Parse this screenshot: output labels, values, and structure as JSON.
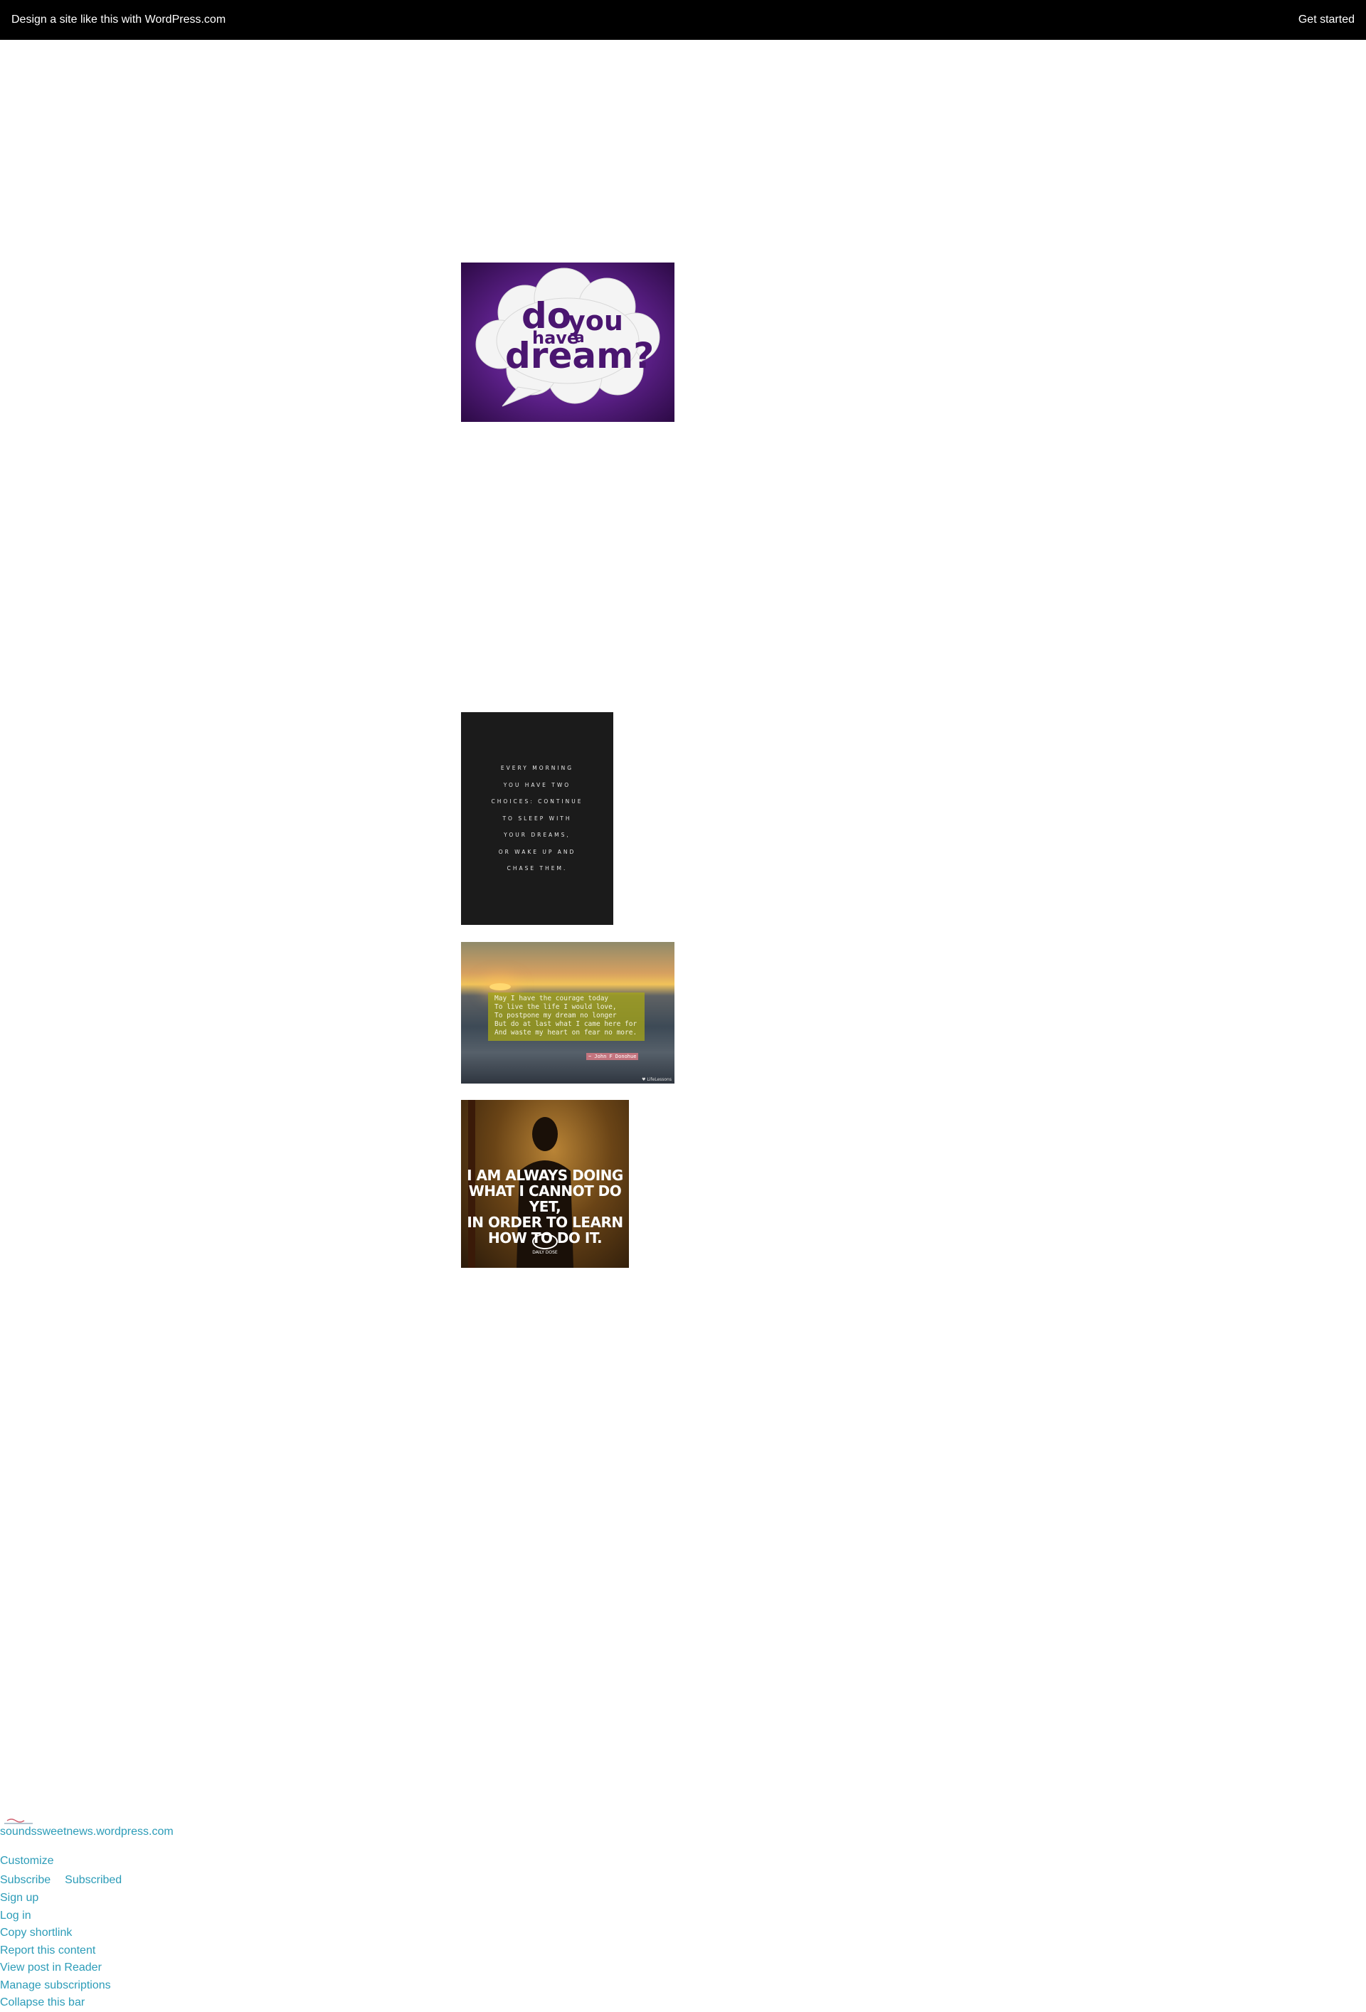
{
  "topbar": {
    "left_text": "Design a site like this with WordPress.com",
    "right_text": "Get started"
  },
  "images": [
    {
      "id": "dream",
      "text": [
        "do",
        "you",
        "have",
        "a",
        "dream?"
      ],
      "colors": {
        "background": "#5a1f86",
        "cloud": "#f4f4f4",
        "text": "#4a1570"
      }
    },
    {
      "id": "morning",
      "lines": [
        "EVERY MORNING",
        "YOU HAVE TWO",
        "CHOICES: CONTINUE",
        "TO SLEEP WITH",
        "YOUR DREAMS,",
        "OR WAKE UP AND",
        "CHASE THEM."
      ]
    },
    {
      "id": "sunset",
      "lines": [
        "May I have the courage today",
        "To live the life I would love,",
        "To postpone my dream no longer",
        "But do at last what I came here for",
        "And waste my heart on fear no more."
      ],
      "author": "~ John F Donohue",
      "watermark": "♥ LifeLessons"
    },
    {
      "id": "always-doing",
      "lines": [
        "I AM ALWAYS DOING",
        "WHAT I CANNOT DO YET,",
        "IN ORDER TO LEARN",
        "HOW TO DO IT."
      ],
      "logo_text": "DAILY DOSE"
    }
  ],
  "footer": {
    "site_url": "soundssweetnews.wordpress.com",
    "customize": "Customize",
    "subscribe": "Subscribe",
    "subscribed": "Subscribed",
    "links": [
      "Sign up",
      "Log in",
      "Copy shortlink",
      "Report this content",
      "View post in Reader",
      "Manage subscriptions",
      "Collapse this bar"
    ]
  },
  "colors": {
    "link": "#2c9cb8",
    "topbar": "#000000"
  }
}
